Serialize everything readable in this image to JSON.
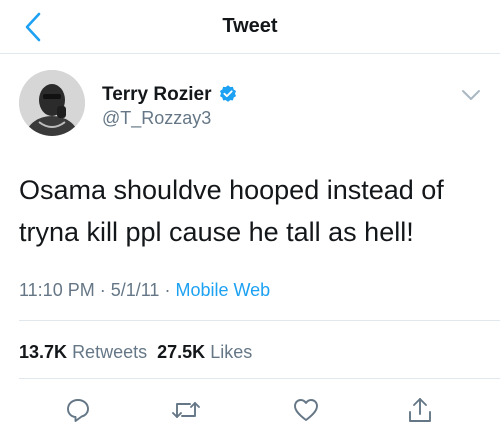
{
  "header": {
    "title": "Tweet"
  },
  "author": {
    "display_name": "Terry Rozier",
    "handle": "@T_Rozzay3"
  },
  "tweet": {
    "text": "Osama shouldve hooped instead of tryna kill ppl cause he tall as hell!",
    "time": "11:10 PM",
    "date": "5/1/11",
    "source": "Mobile Web"
  },
  "stats": {
    "retweets_count": "13.7K",
    "retweets_label": "Retweets",
    "likes_count": "27.5K",
    "likes_label": "Likes"
  },
  "icons": {
    "back": "chevron-left-icon",
    "verified": "verified-badge-icon",
    "caret": "chevron-down-icon",
    "reply": "reply-icon",
    "retweet": "retweet-icon",
    "like": "heart-icon",
    "share": "share-icon"
  },
  "colors": {
    "accent": "#1da1f2",
    "text": "#14171a",
    "secondary": "#657786",
    "divider": "#e1e8ed"
  }
}
